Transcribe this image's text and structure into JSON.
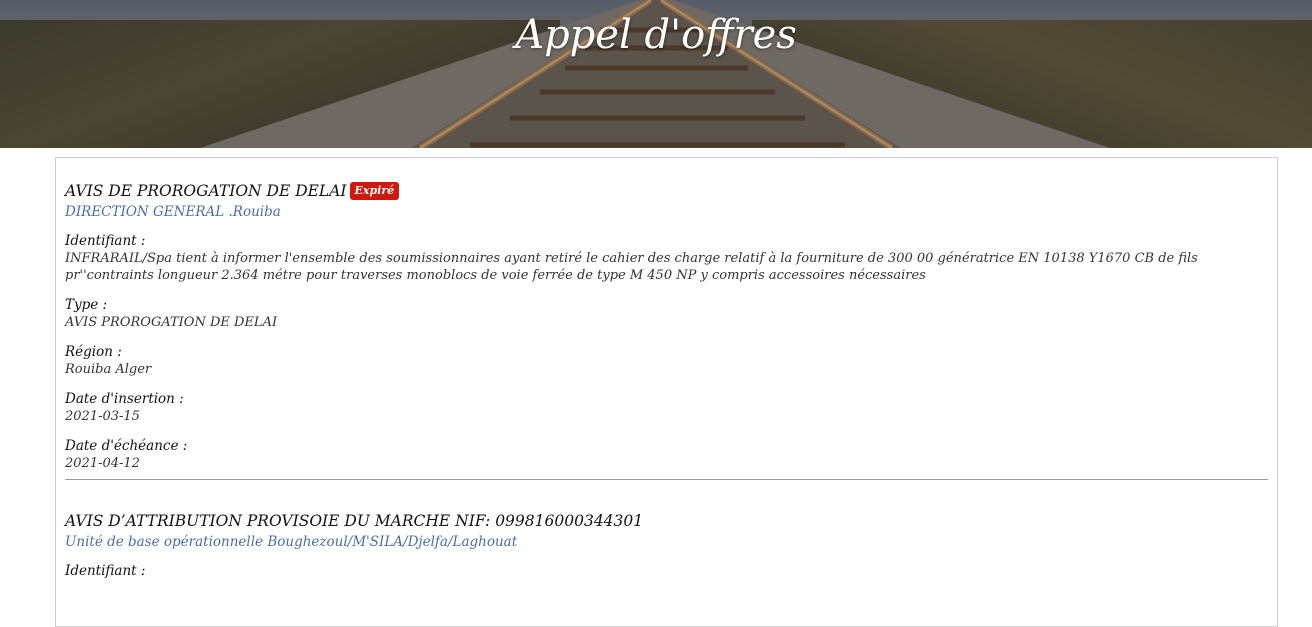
{
  "header": {
    "title": "Appel d'offres"
  },
  "notices": [
    {
      "title": "AVIS DE PROROGATION DE DELAI",
      "badge": "Expiré",
      "organization": "DIRECTION GENERAL .Rouiba",
      "fields": [
        {
          "label": "Identifiant :",
          "value": "INFRARAIL/Spa tient à informer l'ensemble des soumissionnaires ayant retiré le cahier des charge relatif à la fourniture de 300 00 génératrice EN 10138 Y1670 CB de fils pr''contraints longueur 2.364 métre pour traverses monoblocs de voie ferrée de type M 450 NP y compris accessoires nécessaires"
        },
        {
          "label": "Type :",
          "value": "AVIS PROROGATION DE DELAI"
        },
        {
          "label": "Région :",
          "value": "Rouiba Alger"
        },
        {
          "label": "Date d'insertion :",
          "value": "2021-03-15"
        },
        {
          "label": "Date d'échéance :",
          "value": "2021-04-12"
        }
      ]
    },
    {
      "title": "AVIS D’ATTRIBUTION PROVISOIE DU MARCHE NIF: 099816000344301",
      "organization": "Unité de base opérationnelle Boughezoul/M'SILA/Djelfa/Laghouat",
      "fields": [
        {
          "label": "Identifiant :"
        }
      ]
    }
  ],
  "colors": {
    "badge": "#d0190e",
    "link": "#4a6fa5",
    "border": "#cfcfcf"
  }
}
